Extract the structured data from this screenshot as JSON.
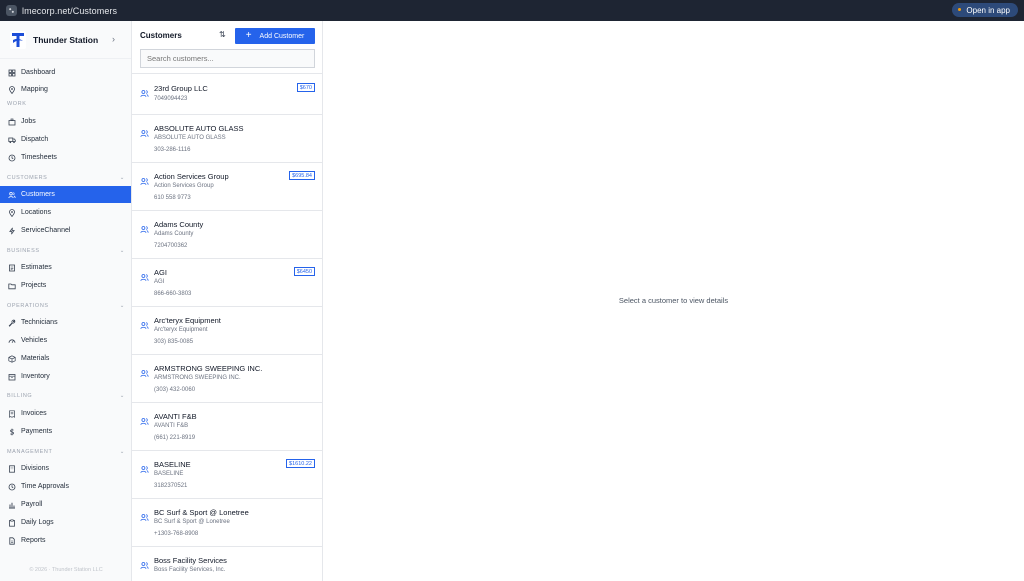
{
  "browser": {
    "url": "lmecorp.net/Customers",
    "open_in_app": "Open in app"
  },
  "brand": {
    "name": "Thunder Station"
  },
  "sidebar": {
    "items": [
      {
        "label": "Dashboard",
        "icon": "grid-icon"
      },
      {
        "label": "Mapping",
        "icon": "map-pin-icon"
      },
      {
        "label": "Jobs",
        "icon": "briefcase-icon"
      },
      {
        "label": "Dispatch",
        "icon": "truck-icon"
      },
      {
        "label": "Timesheets",
        "icon": "clock-icon"
      },
      {
        "label": "Customers",
        "icon": "users-icon",
        "active": true
      },
      {
        "label": "Locations",
        "icon": "location-icon"
      },
      {
        "label": "ServiceChannel",
        "icon": "bolt-icon"
      },
      {
        "label": "Estimates",
        "icon": "document-icon"
      },
      {
        "label": "Projects",
        "icon": "folder-icon"
      },
      {
        "label": "Technicians",
        "icon": "wrench-icon"
      },
      {
        "label": "Vehicles",
        "icon": "gauge-icon"
      },
      {
        "label": "Materials",
        "icon": "box-icon"
      },
      {
        "label": "Inventory",
        "icon": "package-icon"
      },
      {
        "label": "Invoices",
        "icon": "receipt-icon"
      },
      {
        "label": "Payments",
        "icon": "dollar-icon"
      },
      {
        "label": "Divisions",
        "icon": "building-icon"
      },
      {
        "label": "Time Approvals",
        "icon": "clock-check-icon"
      },
      {
        "label": "Payroll",
        "icon": "chart-icon"
      },
      {
        "label": "Daily Logs",
        "icon": "clipboard-icon"
      },
      {
        "label": "Reports",
        "icon": "file-icon"
      }
    ],
    "sections": [
      "WORK",
      "CUSTOMERS",
      "BUSINESS",
      "OPERATIONS",
      "BILLING",
      "MANAGEMENT"
    ],
    "footer": "© 2026 · Thunder Station LLC"
  },
  "customers_panel": {
    "title": "Customers",
    "add_label": "Add Customer",
    "search_placeholder": "Search customers...",
    "list": [
      {
        "name": "23rd Group LLC",
        "company": "",
        "phone": "7049094423",
        "badge": "$670"
      },
      {
        "name": "ABSOLUTE AUTO GLASS",
        "company": "ABSOLUTE AUTO GLASS",
        "phone": "303-286-1116",
        "badge": ""
      },
      {
        "name": "Action Services Group",
        "company": "Action Services Group",
        "phone": "610 558 9773",
        "badge": "$695.84"
      },
      {
        "name": "Adams County",
        "company": "Adams County",
        "phone": "7204700362",
        "badge": ""
      },
      {
        "name": "AGI",
        "company": "AGI",
        "phone": "866-660-3803",
        "badge": "$6450"
      },
      {
        "name": "Arc'teryx Equipment",
        "company": "Arc'teryx Equipment",
        "phone": "303) 835-0085",
        "badge": ""
      },
      {
        "name": "ARMSTRONG SWEEPING INC.",
        "company": "ARMSTRONG SWEEPING INC.",
        "phone": "(303) 432-0060",
        "badge": ""
      },
      {
        "name": "AVANTI F&B",
        "company": "AVANTI F&B",
        "phone": "(661) 221-8919",
        "badge": ""
      },
      {
        "name": "BASELINE",
        "company": "BASELINE",
        "phone": "3182370521",
        "badge": "$1610.22"
      },
      {
        "name": "BC Surf & Sport @ Lonetree",
        "company": "BC Surf & Sport @ Lonetree",
        "phone": "+1303-768-8908",
        "badge": ""
      },
      {
        "name": "Boss Facility Services",
        "company": "Boss Facility Services, Inc.",
        "phone": "",
        "badge": ""
      }
    ]
  },
  "detail": {
    "empty_message": "Select a customer to view details"
  },
  "colors": {
    "accent": "#2563eb",
    "topbar": "#1e2533"
  }
}
